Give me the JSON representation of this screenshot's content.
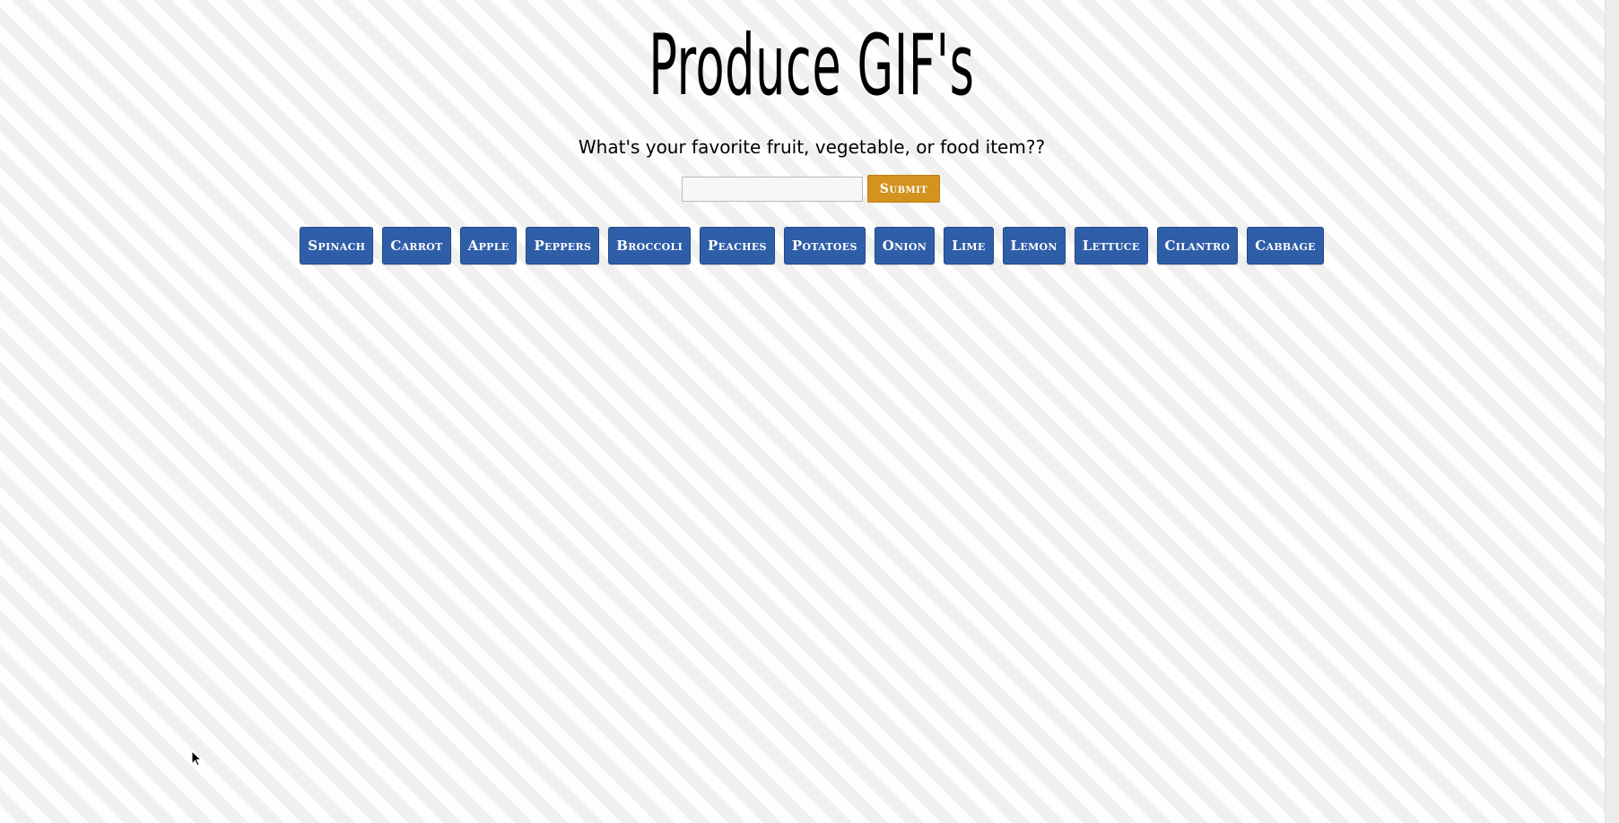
{
  "header": {
    "title": "Produce GIF's",
    "subtitle": "What's your favorite fruit, vegetable, or food item??"
  },
  "search": {
    "value": "",
    "placeholder": "",
    "submit_label": "Submit"
  },
  "produce_buttons": [
    {
      "label": "Spinach"
    },
    {
      "label": "Carrot"
    },
    {
      "label": "Apple"
    },
    {
      "label": "Peppers"
    },
    {
      "label": "Broccoli"
    },
    {
      "label": "Peaches"
    },
    {
      "label": "Potatoes"
    },
    {
      "label": "Onion"
    },
    {
      "label": "Lime"
    },
    {
      "label": "Lemon"
    },
    {
      "label": "Lettuce"
    },
    {
      "label": "Cilantro"
    },
    {
      "label": "Cabbage"
    }
  ],
  "colors": {
    "button_blue": "#2f5ea9",
    "submit_orange": "#d4921e",
    "background": "#f6f6f6"
  },
  "icons": {
    "cursor": "mouse-pointer-icon"
  }
}
